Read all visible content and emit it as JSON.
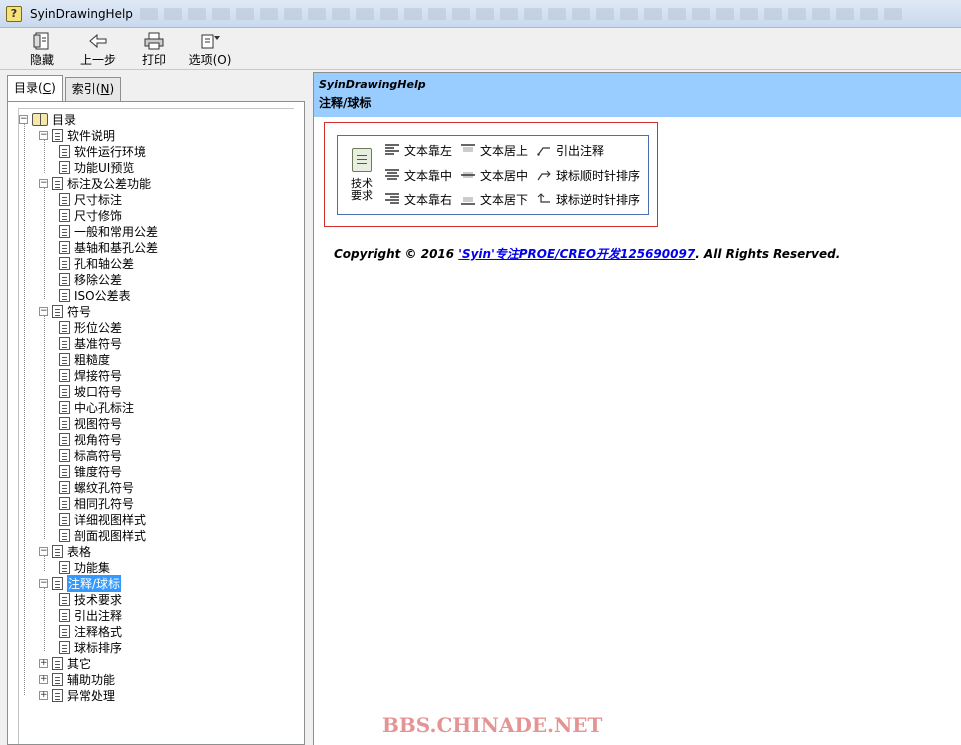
{
  "window": {
    "title": "SyinDrawingHelp"
  },
  "toolbar": {
    "hide_label": "隐藏",
    "back_label": "上一步",
    "print_label": "打印",
    "options_label": "选项(O)"
  },
  "tabs": {
    "contents_label": "目录",
    "contents_key": "C",
    "index_label": "索引",
    "index_key": "N"
  },
  "tree": {
    "root": "目录",
    "g1": "软件说明",
    "g1_items": [
      "软件运行环境",
      "功能UI预览"
    ],
    "g2": "标注及公差功能",
    "g2_items": [
      "尺寸标注",
      "尺寸修饰",
      "一般和常用公差",
      "基轴和基孔公差",
      "孔和轴公差",
      "移除公差",
      "ISO公差表"
    ],
    "g3": "符号",
    "g3_items": [
      "形位公差",
      "基准符号",
      "粗糙度",
      "焊接符号",
      "坡口符号",
      "中心孔标注",
      "视图符号",
      "视角符号",
      "标高符号",
      "锥度符号",
      "螺纹孔符号",
      "相同孔符号",
      "详细视图样式",
      "剖面视图样式"
    ],
    "g4": "表格",
    "g4_items": [
      "功能集"
    ],
    "g5": "注释/球标",
    "g5_items": [
      "技术要求",
      "引出注释",
      "注释格式",
      "球标排序"
    ],
    "g6": "其它",
    "g7": "辅助功能",
    "g8": "异常处理"
  },
  "content": {
    "header_title": "SyinDrawingHelp",
    "header_subtitle": "注释/球标",
    "panel": {
      "big_button": "技术要求",
      "col1": [
        "文本靠左",
        "文本靠中",
        "文本靠右"
      ],
      "col2": [
        "文本居上",
        "文本居中",
        "文本居下"
      ],
      "col3": [
        "引出注释",
        "球标顺时针排序",
        "球标逆时针排序"
      ]
    },
    "copyright_prefix": "Copyright © 2016 ",
    "copyright_link": "'Syin'专注PROE/CREO开发125690097",
    "copyright_suffix": ". All Rights Reserved."
  },
  "watermark": "BBS.CHINADE.NET",
  "colors": {
    "header_bg": "#99ccff",
    "selection": "#3399ff",
    "red_frame": "#d32f2f",
    "watermark": "#e59494"
  }
}
